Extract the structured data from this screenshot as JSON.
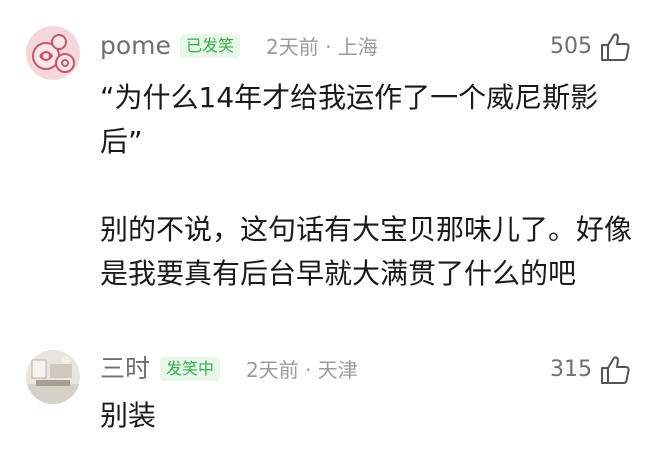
{
  "comments": [
    {
      "username": "pome",
      "badge": "已发笑",
      "meta": "2天前 · 上海",
      "likes": "505",
      "lines": [
        "“为什么14年才给我运作了一个威尼斯影后”",
        "别的不说，这句话有大宝贝那味儿了。好像是我要真有后台早就大满贯了什么的吧"
      ]
    },
    {
      "username": "三时",
      "badge": "发笑中",
      "meta": "2天前 · 天津",
      "likes": "315",
      "lines": [
        "别装"
      ]
    }
  ],
  "icons": {
    "like": "thumbs-up-icon",
    "avatar1": "rose-avatar",
    "avatar2": "room-avatar"
  },
  "colors": {
    "badge_text": "#35b04a",
    "badge_bg": "#e8f7ea",
    "meta": "#9a9a9a"
  }
}
